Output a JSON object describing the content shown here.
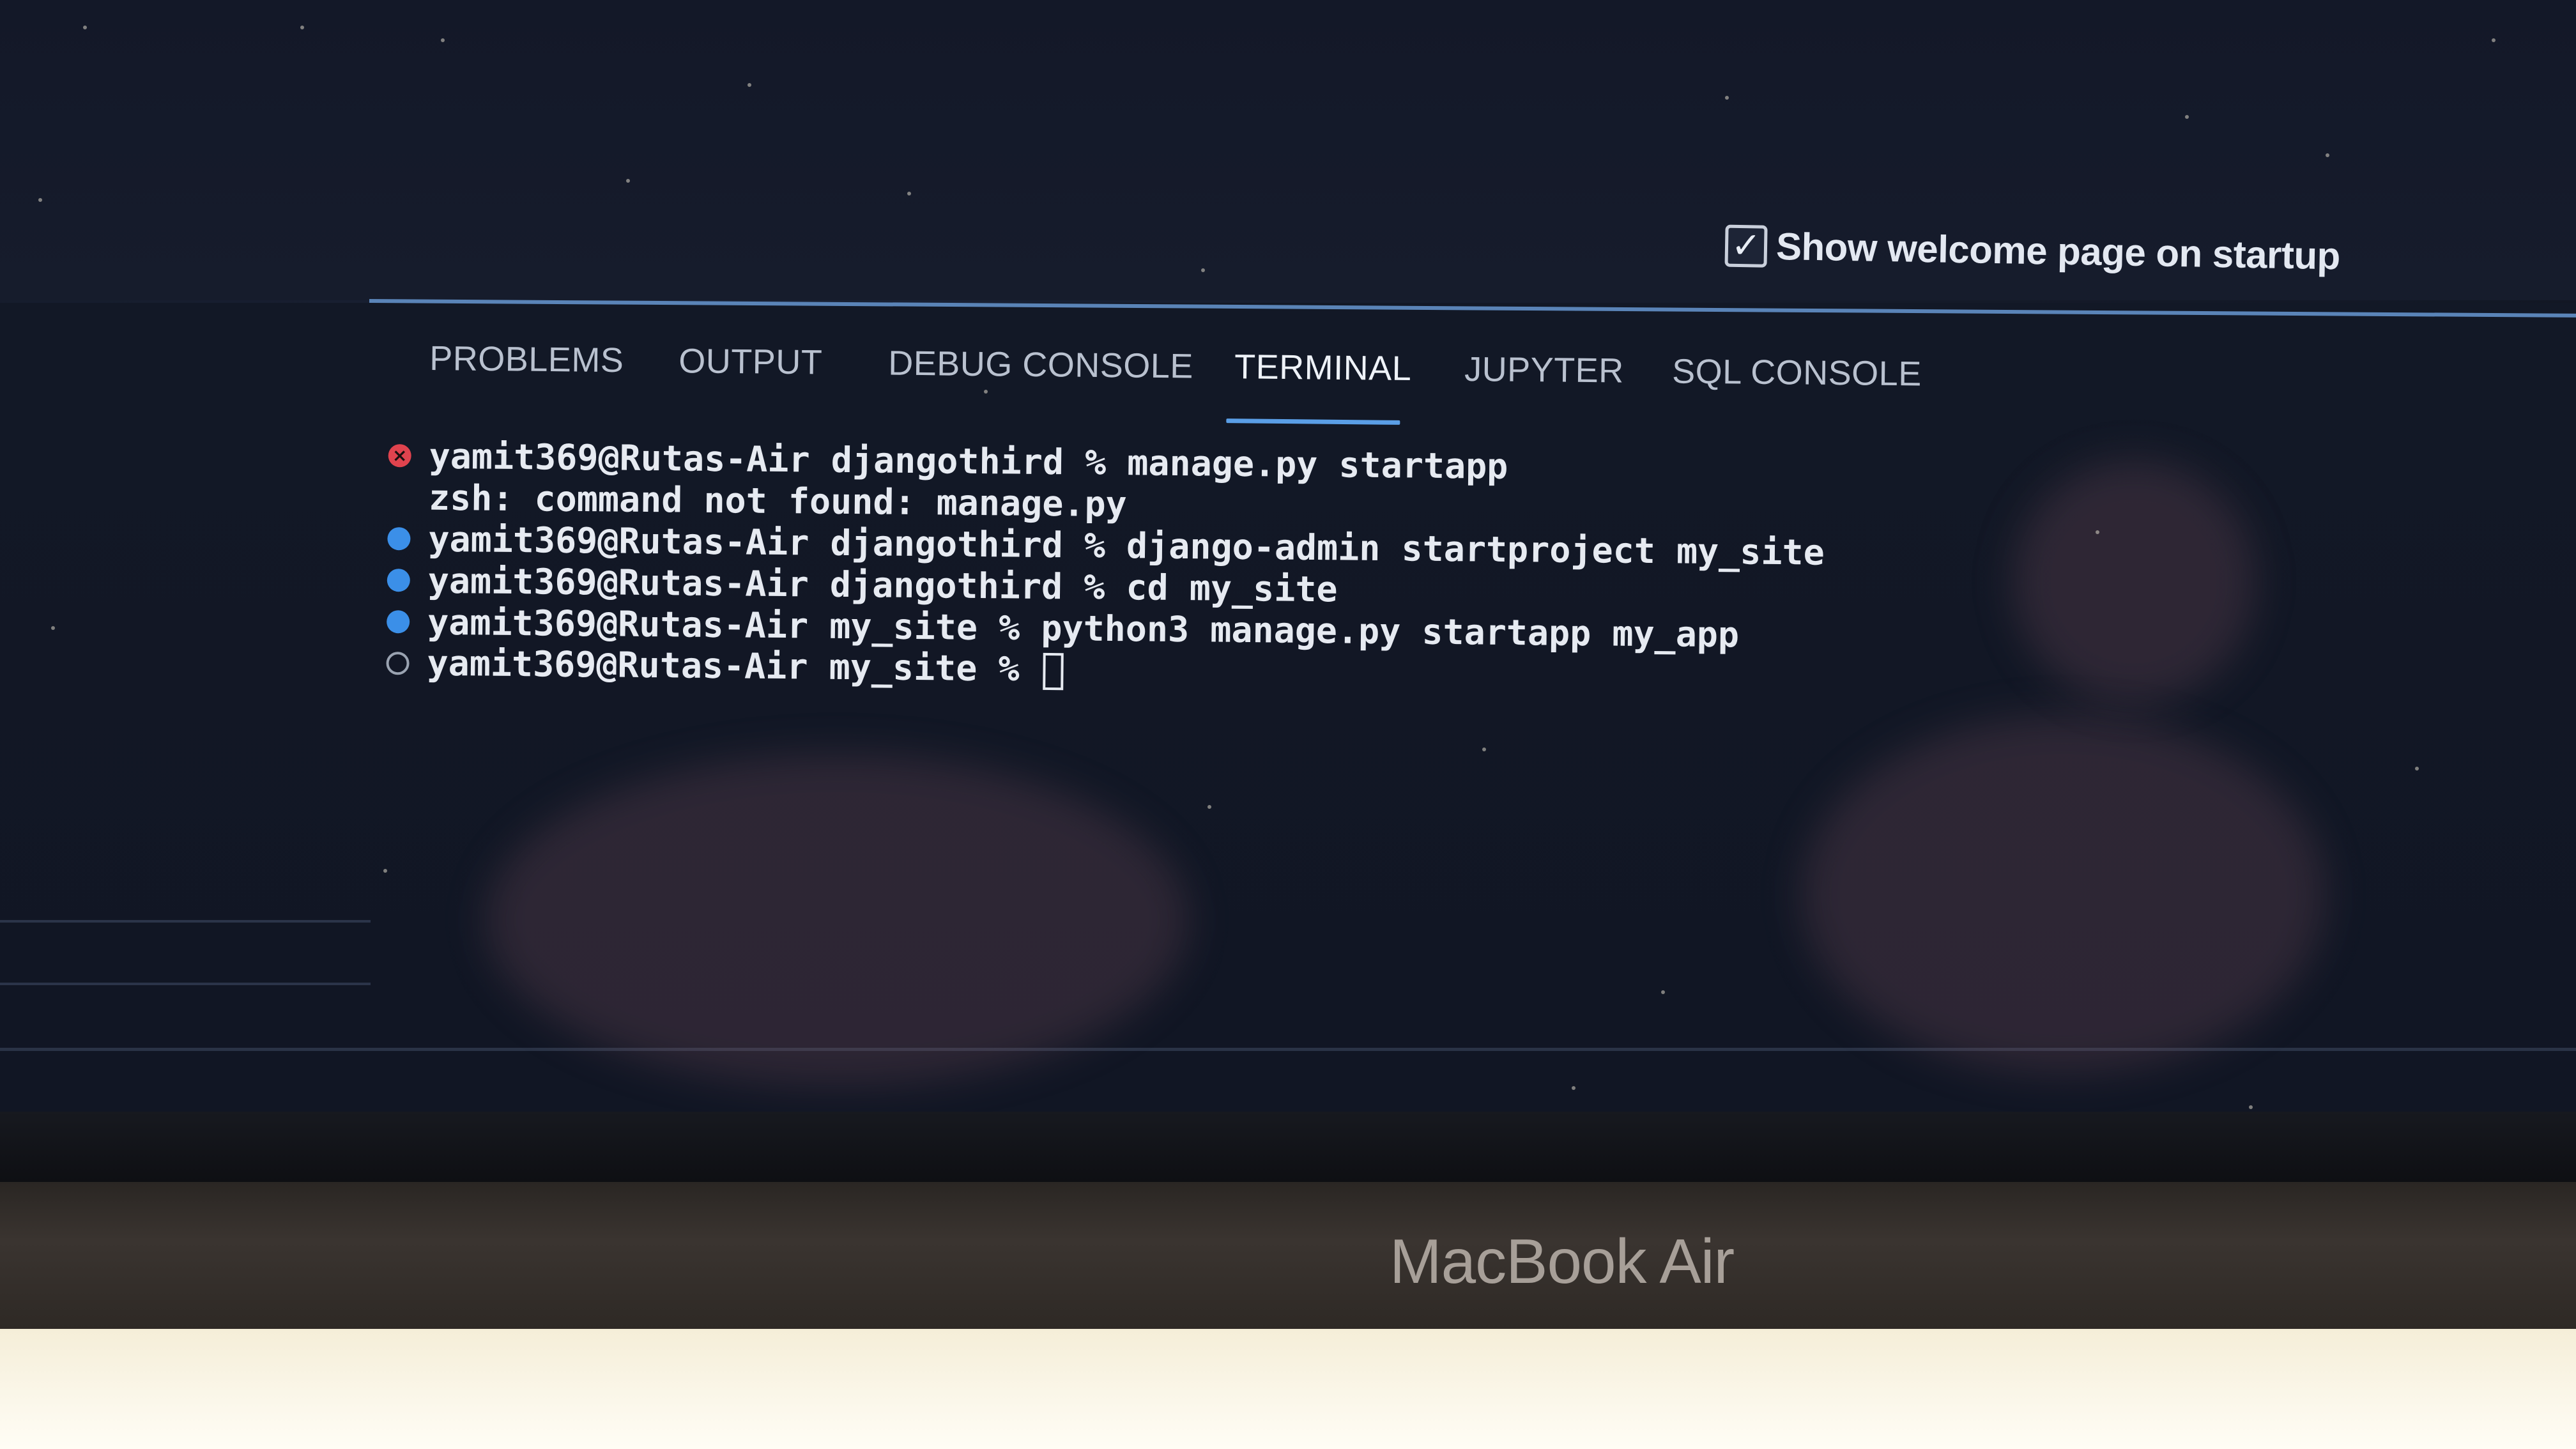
{
  "welcome": {
    "checkbox_checked": true,
    "label": "Show welcome page on startup"
  },
  "panel": {
    "tabs": [
      {
        "label": "PROBLEMS",
        "active": false
      },
      {
        "label": "OUTPUT",
        "active": false
      },
      {
        "label": "DEBUG CONSOLE",
        "active": false
      },
      {
        "label": "TERMINAL",
        "active": true
      },
      {
        "label": "JUPYTER",
        "active": false
      },
      {
        "label": "SQL CONSOLE",
        "active": false
      }
    ]
  },
  "terminal": {
    "lines": [
      {
        "status": "error",
        "text": "yamit369@Rutas-Air djangothird % manage.py startapp"
      },
      {
        "status": "none",
        "text": "zsh: command not found: manage.py"
      },
      {
        "status": "success",
        "text": "yamit369@Rutas-Air djangothird % django-admin startproject my_site"
      },
      {
        "status": "success",
        "text": "yamit369@Rutas-Air djangothird % cd my_site"
      },
      {
        "status": "success",
        "text": "yamit369@Rutas-Air my_site % python3 manage.py startapp my_app"
      },
      {
        "status": "pending",
        "text": "yamit369@Rutas-Air my_site % "
      }
    ]
  },
  "device": {
    "brand": "MacBook Air"
  },
  "colors": {
    "accent_blue": "#3b8fe8",
    "error_red": "#e0434e",
    "panel_border": "#5a84b8"
  },
  "icons": {
    "checkbox": "check-icon",
    "error_status": "error-circle-icon",
    "success_status": "filled-circle-icon",
    "pending_status": "hollow-circle-icon"
  }
}
